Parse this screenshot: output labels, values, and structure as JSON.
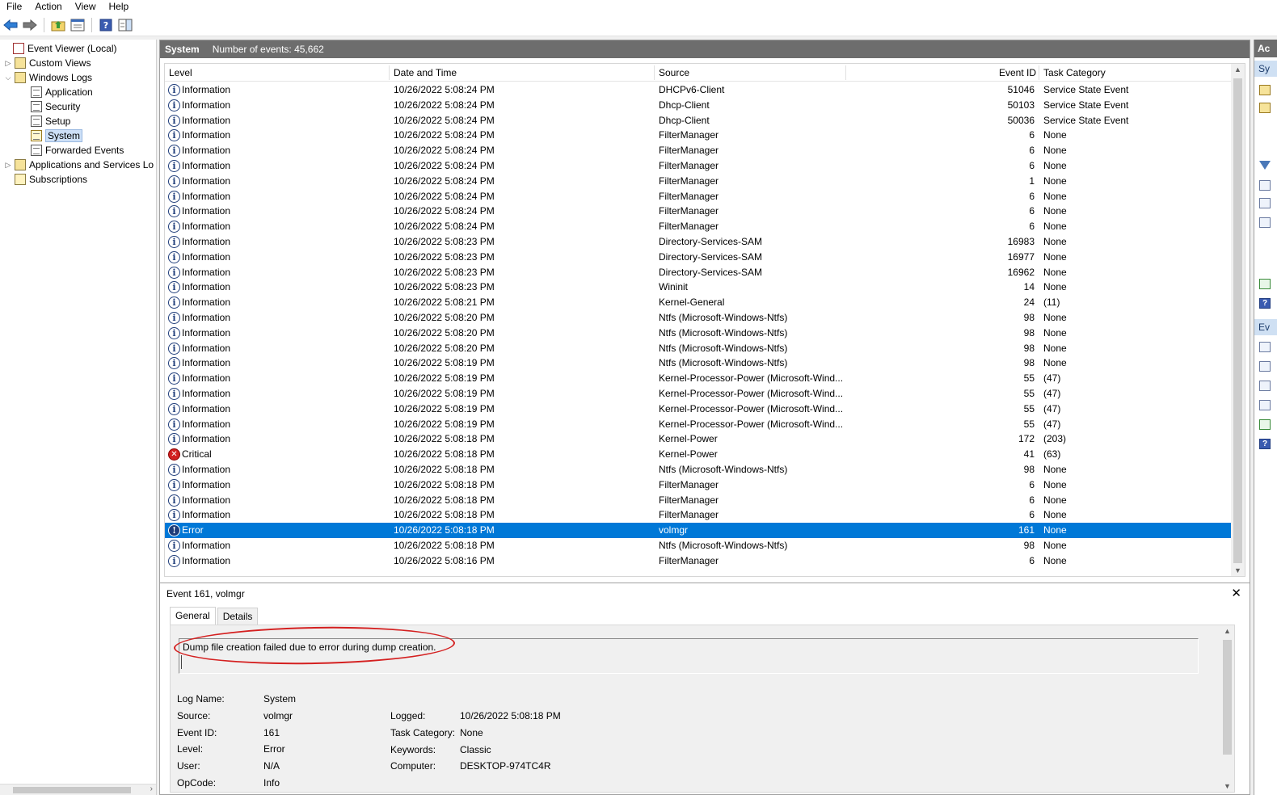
{
  "menu": [
    "File",
    "Action",
    "View",
    "Help"
  ],
  "toolbar": {
    "icons": [
      "back-arrow-icon",
      "forward-arrow-icon",
      "folder-up-icon",
      "properties-icon",
      "help-icon",
      "show-pane-icon"
    ]
  },
  "tree": {
    "items": [
      {
        "label": "Event Viewer (Local)",
        "level": 0,
        "expander": "",
        "icon": "event-viewer-icon"
      },
      {
        "label": "Custom Views",
        "level": 1,
        "expander": ">",
        "icon": "folder-icon"
      },
      {
        "label": "Windows Logs",
        "level": 1,
        "expander": "v",
        "icon": "folder-icon"
      },
      {
        "label": "Application",
        "level": 2,
        "expander": "",
        "icon": "log-icon"
      },
      {
        "label": "Security",
        "level": 2,
        "expander": "",
        "icon": "log-icon"
      },
      {
        "label": "Setup",
        "level": 2,
        "expander": "",
        "icon": "log-icon"
      },
      {
        "label": "System",
        "level": 2,
        "expander": "",
        "icon": "log-icon",
        "selected": true
      },
      {
        "label": "Forwarded Events",
        "level": 2,
        "expander": "",
        "icon": "log-icon"
      },
      {
        "label": "Applications and Services Lo",
        "level": 1,
        "expander": ">",
        "icon": "folder-icon"
      },
      {
        "label": "Subscriptions",
        "level": 1,
        "expander": "",
        "icon": "subscriptions-icon"
      }
    ]
  },
  "main": {
    "title": "System",
    "count_label": "Number of events: 45,662",
    "columns": [
      "Level",
      "Date and Time",
      "Source",
      "Event ID",
      "Task Category"
    ],
    "rows": [
      {
        "level": "Information",
        "date": "10/26/2022 5:08:24 PM",
        "source": "DHCPv6-Client",
        "id": "51046",
        "cat": "Service State Event"
      },
      {
        "level": "Information",
        "date": "10/26/2022 5:08:24 PM",
        "source": "Dhcp-Client",
        "id": "50103",
        "cat": "Service State Event"
      },
      {
        "level": "Information",
        "date": "10/26/2022 5:08:24 PM",
        "source": "Dhcp-Client",
        "id": "50036",
        "cat": "Service State Event"
      },
      {
        "level": "Information",
        "date": "10/26/2022 5:08:24 PM",
        "source": "FilterManager",
        "id": "6",
        "cat": "None"
      },
      {
        "level": "Information",
        "date": "10/26/2022 5:08:24 PM",
        "source": "FilterManager",
        "id": "6",
        "cat": "None"
      },
      {
        "level": "Information",
        "date": "10/26/2022 5:08:24 PM",
        "source": "FilterManager",
        "id": "6",
        "cat": "None"
      },
      {
        "level": "Information",
        "date": "10/26/2022 5:08:24 PM",
        "source": "FilterManager",
        "id": "1",
        "cat": "None"
      },
      {
        "level": "Information",
        "date": "10/26/2022 5:08:24 PM",
        "source": "FilterManager",
        "id": "6",
        "cat": "None"
      },
      {
        "level": "Information",
        "date": "10/26/2022 5:08:24 PM",
        "source": "FilterManager",
        "id": "6",
        "cat": "None"
      },
      {
        "level": "Information",
        "date": "10/26/2022 5:08:24 PM",
        "source": "FilterManager",
        "id": "6",
        "cat": "None"
      },
      {
        "level": "Information",
        "date": "10/26/2022 5:08:23 PM",
        "source": "Directory-Services-SAM",
        "id": "16983",
        "cat": "None"
      },
      {
        "level": "Information",
        "date": "10/26/2022 5:08:23 PM",
        "source": "Directory-Services-SAM",
        "id": "16977",
        "cat": "None"
      },
      {
        "level": "Information",
        "date": "10/26/2022 5:08:23 PM",
        "source": "Directory-Services-SAM",
        "id": "16962",
        "cat": "None"
      },
      {
        "level": "Information",
        "date": "10/26/2022 5:08:23 PM",
        "source": "Wininit",
        "id": "14",
        "cat": "None"
      },
      {
        "level": "Information",
        "date": "10/26/2022 5:08:21 PM",
        "source": "Kernel-General",
        "id": "24",
        "cat": "(11)"
      },
      {
        "level": "Information",
        "date": "10/26/2022 5:08:20 PM",
        "source": "Ntfs (Microsoft-Windows-Ntfs)",
        "id": "98",
        "cat": "None"
      },
      {
        "level": "Information",
        "date": "10/26/2022 5:08:20 PM",
        "source": "Ntfs (Microsoft-Windows-Ntfs)",
        "id": "98",
        "cat": "None"
      },
      {
        "level": "Information",
        "date": "10/26/2022 5:08:20 PM",
        "source": "Ntfs (Microsoft-Windows-Ntfs)",
        "id": "98",
        "cat": "None"
      },
      {
        "level": "Information",
        "date": "10/26/2022 5:08:19 PM",
        "source": "Ntfs (Microsoft-Windows-Ntfs)",
        "id": "98",
        "cat": "None"
      },
      {
        "level": "Information",
        "date": "10/26/2022 5:08:19 PM",
        "source": "Kernel-Processor-Power (Microsoft-Wind...",
        "id": "55",
        "cat": "(47)"
      },
      {
        "level": "Information",
        "date": "10/26/2022 5:08:19 PM",
        "source": "Kernel-Processor-Power (Microsoft-Wind...",
        "id": "55",
        "cat": "(47)"
      },
      {
        "level": "Information",
        "date": "10/26/2022 5:08:19 PM",
        "source": "Kernel-Processor-Power (Microsoft-Wind...",
        "id": "55",
        "cat": "(47)"
      },
      {
        "level": "Information",
        "date": "10/26/2022 5:08:19 PM",
        "source": "Kernel-Processor-Power (Microsoft-Wind...",
        "id": "55",
        "cat": "(47)"
      },
      {
        "level": "Information",
        "date": "10/26/2022 5:08:18 PM",
        "source": "Kernel-Power",
        "id": "172",
        "cat": "(203)"
      },
      {
        "level": "Critical",
        "date": "10/26/2022 5:08:18 PM",
        "source": "Kernel-Power",
        "id": "41",
        "cat": "(63)"
      },
      {
        "level": "Information",
        "date": "10/26/2022 5:08:18 PM",
        "source": "Ntfs (Microsoft-Windows-Ntfs)",
        "id": "98",
        "cat": "None"
      },
      {
        "level": "Information",
        "date": "10/26/2022 5:08:18 PM",
        "source": "FilterManager",
        "id": "6",
        "cat": "None"
      },
      {
        "level": "Information",
        "date": "10/26/2022 5:08:18 PM",
        "source": "FilterManager",
        "id": "6",
        "cat": "None"
      },
      {
        "level": "Information",
        "date": "10/26/2022 5:08:18 PM",
        "source": "FilterManager",
        "id": "6",
        "cat": "None"
      },
      {
        "level": "Error",
        "date": "10/26/2022 5:08:18 PM",
        "source": "volmgr",
        "id": "161",
        "cat": "None",
        "selected": true
      },
      {
        "level": "Information",
        "date": "10/26/2022 5:08:18 PM",
        "source": "Ntfs (Microsoft-Windows-Ntfs)",
        "id": "98",
        "cat": "None"
      },
      {
        "level": "Information",
        "date": "10/26/2022 5:08:16 PM",
        "source": "FilterManager",
        "id": "6",
        "cat": "None"
      }
    ]
  },
  "detail": {
    "title": "Event 161, volmgr",
    "tabs": [
      "General",
      "Details"
    ],
    "message": "Dump file creation failed due to error during dump creation.",
    "fields_left": [
      {
        "k": "Log Name:",
        "v": "System"
      },
      {
        "k": "Source:",
        "v": "volmgr"
      },
      {
        "k": "Event ID:",
        "v": "161"
      },
      {
        "k": "Level:",
        "v": "Error"
      },
      {
        "k": "User:",
        "v": "N/A"
      },
      {
        "k": "OpCode:",
        "v": "Info"
      }
    ],
    "fields_right": [
      {
        "k": "Logged:",
        "v": "10/26/2022 5:08:18 PM"
      },
      {
        "k": "Task Category:",
        "v": "None"
      },
      {
        "k": "Keywords:",
        "v": "Classic"
      },
      {
        "k": "Computer:",
        "v": "DESKTOP-974TC4R"
      }
    ]
  },
  "actions": {
    "title": "Ac",
    "sub1": "Sy",
    "sub2": "Ev"
  },
  "colors": {
    "selection": "#0078d7",
    "header_bar": "#6d6d6d",
    "annotation": "#d42020"
  }
}
